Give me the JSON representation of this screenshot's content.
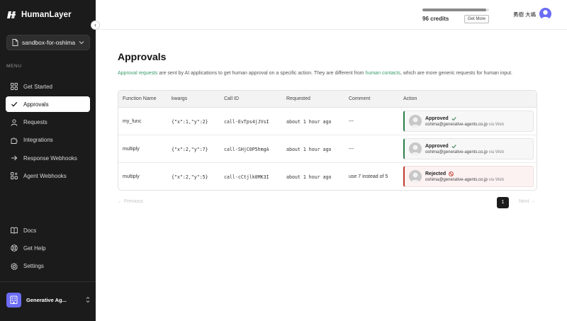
{
  "brand": {
    "name": "HumanLayer"
  },
  "sidebar": {
    "project": "sandbox-for-oshima",
    "menu_label": "MENU",
    "items": [
      {
        "label": "Get Started",
        "icon": "grid-icon"
      },
      {
        "label": "Approvals",
        "icon": "check-icon",
        "active": true
      },
      {
        "label": "Requests",
        "icon": "user-icon"
      },
      {
        "label": "Integrations",
        "icon": "puzzle-icon"
      },
      {
        "label": "Response Webhooks",
        "icon": "arrow-right-icon"
      },
      {
        "label": "Agent Webhooks",
        "icon": "webhook-icon"
      }
    ],
    "bottom_items": [
      {
        "label": "Docs",
        "icon": "book-icon"
      },
      {
        "label": "Get Help",
        "icon": "lifebuoy-icon"
      },
      {
        "label": "Settings",
        "icon": "gear-icon"
      }
    ],
    "org": {
      "name": "Generative Ag..."
    }
  },
  "topbar": {
    "credits_text": "96 credits",
    "credits_progress": 0.96,
    "get_more_label": "Get More",
    "user_name": "勇樹 大嶋"
  },
  "page": {
    "title": "Approvals",
    "desc_link1": "Approval requests",
    "desc_text1": " are sent by AI applications to get human approval on a specific action. They are different from ",
    "desc_link2": "human contacts",
    "desc_text2": ", which are more generic requests for human input."
  },
  "table": {
    "headers": {
      "fn": "Function Name",
      "kwargs": "kwargs",
      "call": "Call ID",
      "requested": "Requested",
      "comment": "Comment",
      "action": "Action"
    },
    "rows": [
      {
        "fn": "my_func",
        "kwargs": "{\"x\":1,\"y\":2}",
        "call": "call-EvTps4jJVsI",
        "requested": "about 1 hour ago",
        "comment": "---",
        "status": "Approved",
        "email": "oshima@generative-agents.co.jp",
        "via": "via Web"
      },
      {
        "fn": "multiply",
        "kwargs": "{\"x\":2,\"y\":7}",
        "call": "call-SHjC0P5hmgA",
        "requested": "about 1 hour ago",
        "comment": "---",
        "status": "Approved",
        "email": "oshima@generative-agents.co.jp",
        "via": "via Web"
      },
      {
        "fn": "multiply",
        "kwargs": "{\"x\":2,\"y\":5}",
        "call": "call-cCtjlk0MK3I",
        "requested": "about 1 hour ago",
        "comment": "use 7 instead of 5",
        "status": "Rejected",
        "email": "oshima@generative-agents.co.jp",
        "via": "via Web"
      }
    ]
  },
  "pagination": {
    "prev": "← Previous",
    "page": "1",
    "next": "Next →"
  },
  "colors": {
    "accent_link": "#3a9d6a",
    "approved": "#2e7d4a",
    "rejected": "#c0392b",
    "avatar": "#6b6cf6"
  }
}
